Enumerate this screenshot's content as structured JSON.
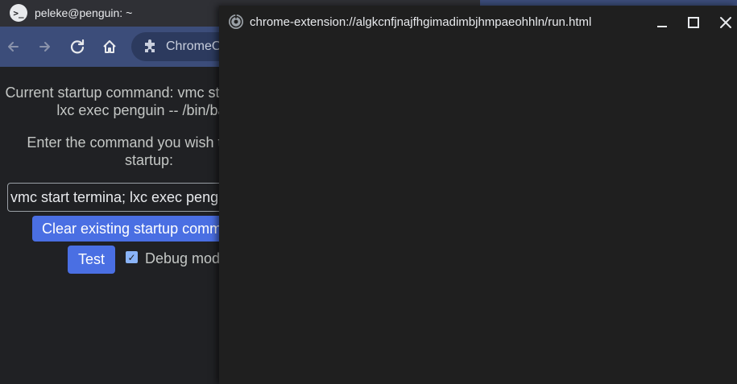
{
  "terminal": {
    "title": "peleke@penguin: ~",
    "icon": "terminal-prompt-icon",
    "icon_glyph": ">_"
  },
  "browser": {
    "omnibox_text": "ChromeOS",
    "back_icon": "arrow-back-icon",
    "forward_icon": "arrow-forward-icon",
    "reload_icon": "reload-icon",
    "home_icon": "home-icon",
    "extension_icon": "puzzle-piece-icon"
  },
  "extension_page": {
    "current_command_line1": "Current startup command: vmc start termina;",
    "current_command_line2": "lxc exec penguin -- /bin/bash",
    "prompt_line1": "Enter the command you wish to run at",
    "prompt_line2": "startup:",
    "command_input_value": "vmc start termina; lxc exec penguin -- /bin/bash",
    "clear_button_label": "Clear existing startup command",
    "test_button_label": "Test",
    "debug_checkbox_checked": true,
    "debug_label": "Debug mode"
  },
  "popup": {
    "title": "chrome-extension://algkcnfjnajfhgimadimbjhmpaeohhln/run.html",
    "icon": "extension-globe-icon",
    "minimize_icon": "minimize-icon",
    "maximize_icon": "maximize-icon",
    "close_icon": "close-icon"
  },
  "colors": {
    "background": "#202124",
    "toolbar": "#3c4d7a",
    "button_primary": "#4a6fe3",
    "checkbox": "#8ab4f8",
    "popup_bg": "#1f1f1f"
  }
}
